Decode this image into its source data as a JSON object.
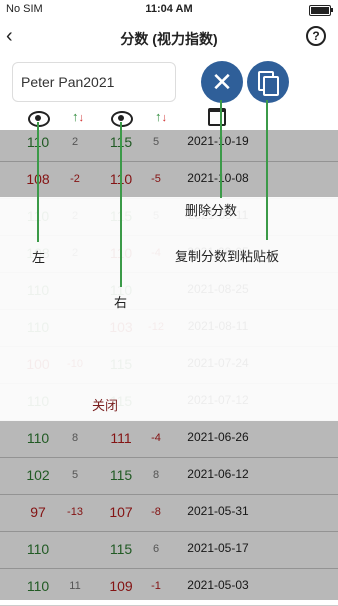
{
  "status_bar": {
    "carrier": "No SIM",
    "time": "11:04 AM"
  },
  "nav": {
    "title": "分数 (视力指数)",
    "back_icon": "chevron-left-icon",
    "help_icon": "question-circle-icon"
  },
  "name_field": {
    "value": "Peter Pan2021"
  },
  "actions": {
    "delete_icon": "close-icon",
    "copy_icon": "copy-icon"
  },
  "rows": [
    {
      "left": "110",
      "left_diff": "2",
      "right": "115",
      "right_diff": "5",
      "date": "2021-10-19"
    },
    {
      "left": "108",
      "left_diff": "-2",
      "right": "110",
      "right_diff": "-5",
      "date": "2021-10-08"
    },
    {
      "left": "110",
      "left_diff": "2",
      "right": "115",
      "right_diff": "5",
      "date": "2021-09-11"
    },
    {
      "left": "108",
      "left_diff": "2",
      "right": "110",
      "right_diff": "-4",
      "date": "2021-09-05"
    },
    {
      "left": "110",
      "left_diff": "",
      "right": "110",
      "right_diff": "",
      "date": "2021-08-25"
    },
    {
      "left": "110",
      "left_diff": "",
      "right": "103",
      "right_diff": "-12",
      "date": "2021-08-11"
    },
    {
      "left": "100",
      "left_diff": "-10",
      "right": "115",
      "right_diff": "",
      "date": "2021-07-24"
    },
    {
      "left": "110",
      "left_diff": "",
      "right": "115",
      "right_diff": "",
      "date": "2021-07-12"
    },
    {
      "left": "110",
      "left_diff": "8",
      "right": "111",
      "right_diff": "-4",
      "date": "2021-06-26"
    },
    {
      "left": "102",
      "left_diff": "5",
      "right": "115",
      "right_diff": "8",
      "date": "2021-06-12"
    },
    {
      "left": "97",
      "left_diff": "-13",
      "right": "107",
      "right_diff": "-8",
      "date": "2021-05-31"
    },
    {
      "left": "110",
      "left_diff": "",
      "right": "115",
      "right_diff": "6",
      "date": "2021-05-17"
    },
    {
      "left": "110",
      "left_diff": "11",
      "right": "109",
      "right_diff": "-1",
      "date": "2021-05-03"
    }
  ],
  "overlay": {
    "close_label": "关闭",
    "tips": {
      "delete": "删除分数",
      "copy": "复制分数到粘贴板",
      "left": "左",
      "right": "右"
    }
  }
}
